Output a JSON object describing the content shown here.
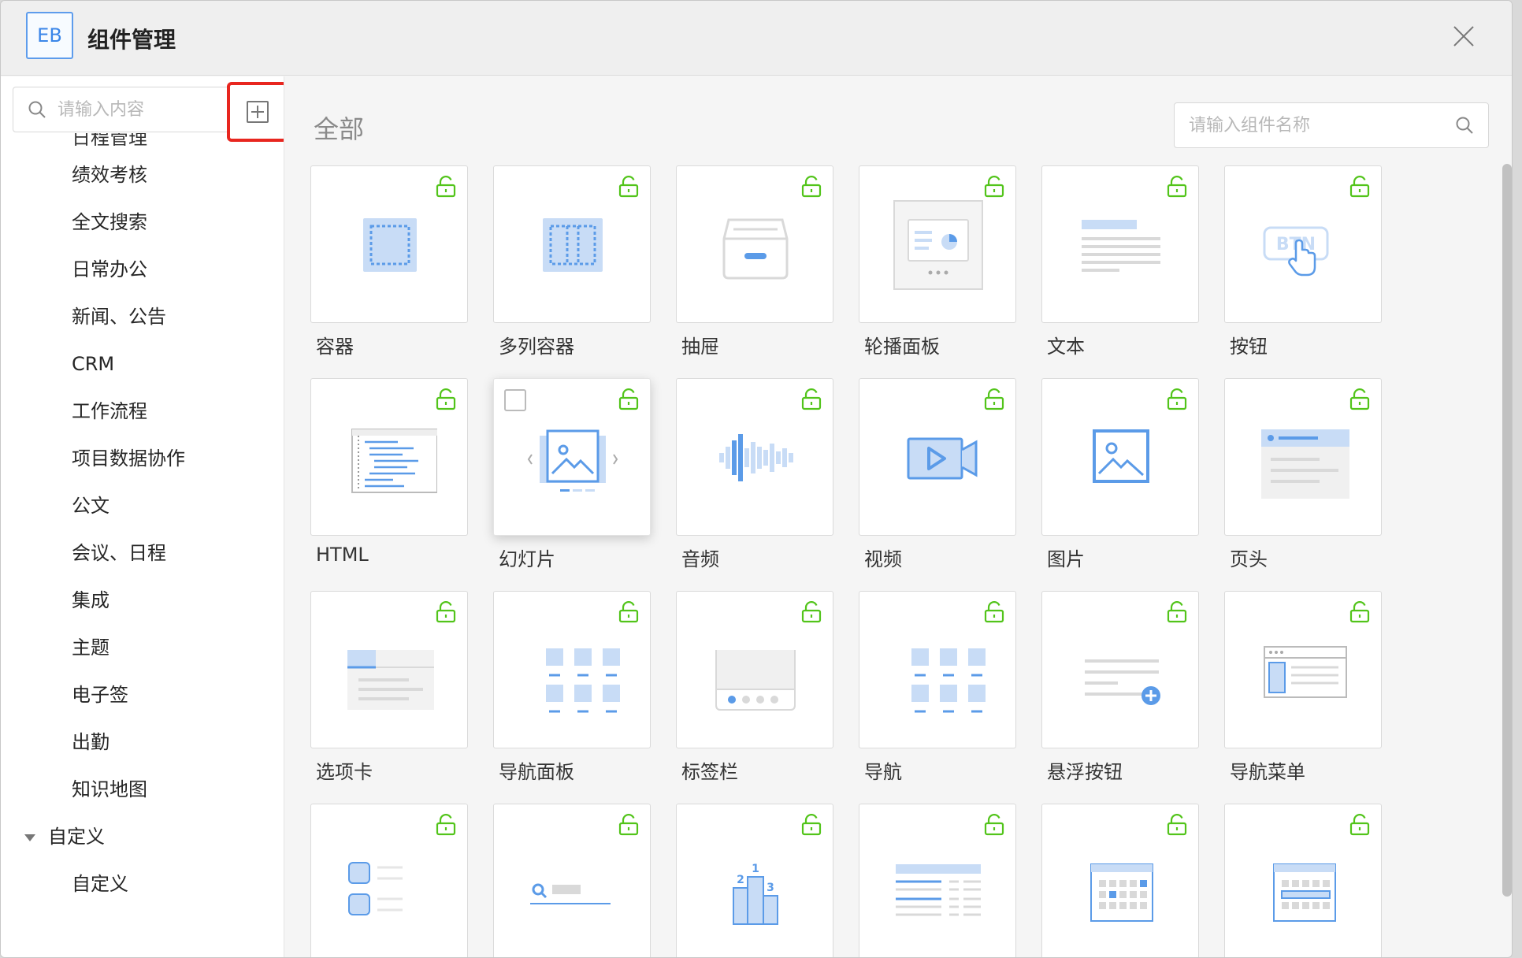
{
  "header": {
    "logo": "EB",
    "title": "组件管理"
  },
  "sidebar": {
    "search_placeholder": "请输入内容",
    "partial_item": "日程管理",
    "items": [
      "绩效考核",
      "全文搜索",
      "日常办公",
      "新闻、公告",
      "CRM",
      "工作流程",
      "项目数据协作",
      "公文",
      "会议、日程",
      "集成",
      "主题",
      "电子签",
      "出勤",
      "知识地图"
    ],
    "group": {
      "label": "自定义",
      "children": [
        "自定义"
      ]
    }
  },
  "main": {
    "title": "全部",
    "search_placeholder": "请输入组件名称",
    "components": [
      {
        "label": "容器",
        "icon": "container-icon"
      },
      {
        "label": "多列容器",
        "icon": "multi-column-container-icon"
      },
      {
        "label": "抽屉",
        "icon": "drawer-icon"
      },
      {
        "label": "轮播面板",
        "icon": "carousel-panel-icon"
      },
      {
        "label": "文本",
        "icon": "text-icon"
      },
      {
        "label": "按钮",
        "icon": "button-icon"
      },
      {
        "label": "HTML",
        "icon": "html-icon"
      },
      {
        "label": "幻灯片",
        "icon": "slideshow-icon"
      },
      {
        "label": "音频",
        "icon": "audio-icon"
      },
      {
        "label": "视频",
        "icon": "video-icon"
      },
      {
        "label": "图片",
        "icon": "image-icon"
      },
      {
        "label": "页头",
        "icon": "page-header-icon"
      },
      {
        "label": "选项卡",
        "icon": "tabs-icon"
      },
      {
        "label": "导航面板",
        "icon": "nav-panel-icon"
      },
      {
        "label": "标签栏",
        "icon": "tab-bar-icon"
      },
      {
        "label": "导航",
        "icon": "nav-icon"
      },
      {
        "label": "悬浮按钮",
        "icon": "floating-button-icon"
      },
      {
        "label": "导航菜单",
        "icon": "nav-menu-icon"
      },
      {
        "label": "",
        "icon": "list-icon"
      },
      {
        "label": "",
        "icon": "search-bar-icon"
      },
      {
        "label": "",
        "icon": "ranking-icon"
      },
      {
        "label": "",
        "icon": "table-icon"
      },
      {
        "label": "",
        "icon": "calendar-icon"
      },
      {
        "label": "",
        "icon": "calendar-week-icon"
      }
    ],
    "icon_texts": {
      "button": "BTN",
      "rank_1": "1",
      "rank_2": "2",
      "rank_3": "3"
    }
  },
  "colors": {
    "accent": "#5b9be8",
    "light_accent": "#c8dcf6",
    "lock": "#52c41a",
    "highlight_border": "#e8261f"
  }
}
